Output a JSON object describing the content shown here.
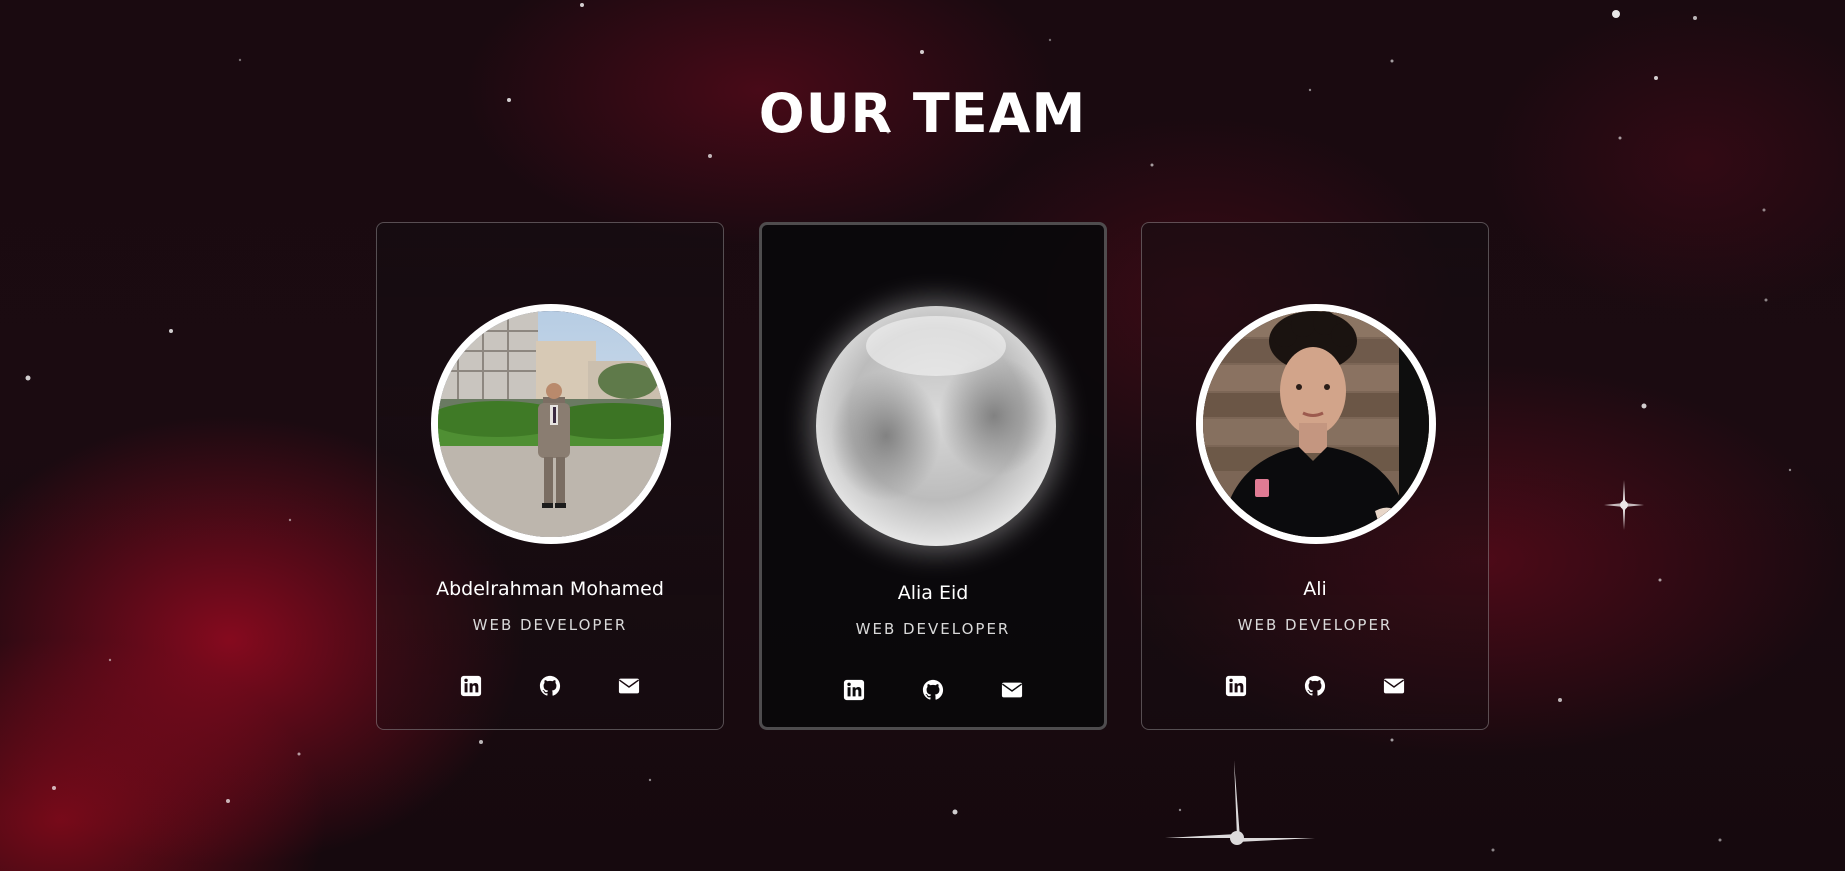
{
  "page": {
    "title": "OUR TEAM"
  },
  "team": [
    {
      "name": "Abdelrahman Mohamed",
      "role": "WEB DEVELOPER",
      "photo": "man-in-suit-on-campus-photo",
      "links": [
        "linkedin-icon",
        "github-icon",
        "email-icon"
      ]
    },
    {
      "name": "Alia Eid",
      "role": "WEB DEVELOPER",
      "photo": "blurred-placeholder-photo",
      "links": [
        "linkedin-icon",
        "github-icon",
        "email-icon"
      ]
    },
    {
      "name": "Ali",
      "role": "WEB DEVELOPER",
      "photo": "young-man-black-polo-photo",
      "links": [
        "linkedin-icon",
        "github-icon",
        "email-icon"
      ]
    }
  ],
  "colors": {
    "background": "#1a0a10",
    "nebula": "#aa0a23",
    "text": "#ffffff",
    "card_border": "#5a5055"
  }
}
